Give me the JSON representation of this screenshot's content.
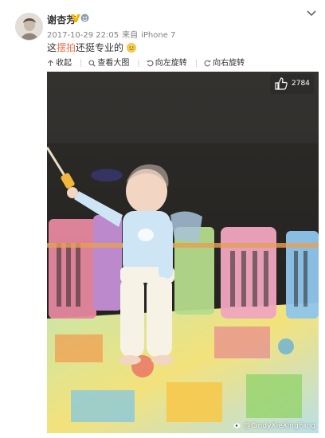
{
  "post": {
    "author_name": "谢杏芳",
    "timestamp": "2017-10-29 22:05",
    "source_prefix": "来自",
    "source": "iPhone 7",
    "text_before": "这",
    "text_highlight": "摆拍",
    "text_after": "还挺专业的"
  },
  "toolbar": {
    "collapse_label": "收起",
    "view_large_label": "查看大图",
    "rotate_left_label": "向左旋转",
    "rotate_right_label": "向右旋转"
  },
  "photo": {
    "like_count": "2784",
    "watermark": "@CindyXieXingFang"
  },
  "colors": {
    "highlight": "#eb7350",
    "verified_badge": "#f8b500"
  }
}
